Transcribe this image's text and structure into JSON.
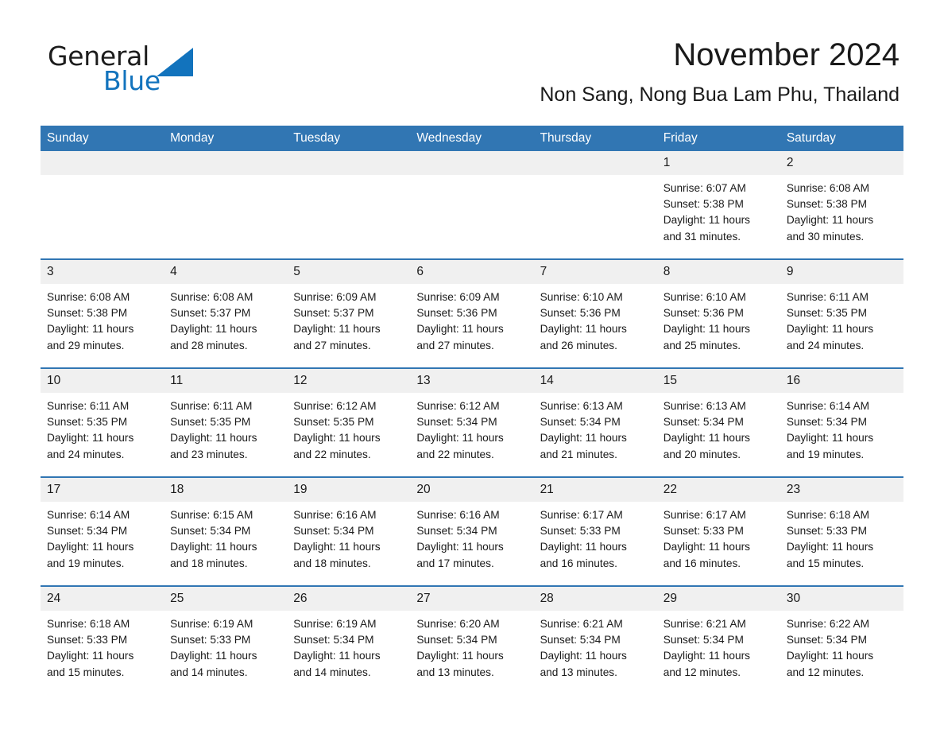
{
  "logo": {
    "word_one": "General",
    "word_two": "Blue",
    "triangle_icon": "triangle-icon",
    "brand_blue": "#1273bd"
  },
  "header": {
    "title": "November 2024",
    "subtitle": "Non Sang, Nong Bua Lam Phu, Thailand"
  },
  "theme": {
    "header_blue": "#3176b3",
    "daynum_gray": "#f0f0f0",
    "text": "#1a1a1a"
  },
  "calendar": {
    "weekday_headers": [
      "Sunday",
      "Monday",
      "Tuesday",
      "Wednesday",
      "Thursday",
      "Friday",
      "Saturday"
    ],
    "weeks": [
      {
        "days": [
          {
            "num": "",
            "sunrise": "",
            "sunset": "",
            "daylight1": "",
            "daylight2": ""
          },
          {
            "num": "",
            "sunrise": "",
            "sunset": "",
            "daylight1": "",
            "daylight2": ""
          },
          {
            "num": "",
            "sunrise": "",
            "sunset": "",
            "daylight1": "",
            "daylight2": ""
          },
          {
            "num": "",
            "sunrise": "",
            "sunset": "",
            "daylight1": "",
            "daylight2": ""
          },
          {
            "num": "",
            "sunrise": "",
            "sunset": "",
            "daylight1": "",
            "daylight2": ""
          },
          {
            "num": "1",
            "sunrise": "Sunrise: 6:07 AM",
            "sunset": "Sunset: 5:38 PM",
            "daylight1": "Daylight: 11 hours",
            "daylight2": "and 31 minutes."
          },
          {
            "num": "2",
            "sunrise": "Sunrise: 6:08 AM",
            "sunset": "Sunset: 5:38 PM",
            "daylight1": "Daylight: 11 hours",
            "daylight2": "and 30 minutes."
          }
        ]
      },
      {
        "days": [
          {
            "num": "3",
            "sunrise": "Sunrise: 6:08 AM",
            "sunset": "Sunset: 5:38 PM",
            "daylight1": "Daylight: 11 hours",
            "daylight2": "and 29 minutes."
          },
          {
            "num": "4",
            "sunrise": "Sunrise: 6:08 AM",
            "sunset": "Sunset: 5:37 PM",
            "daylight1": "Daylight: 11 hours",
            "daylight2": "and 28 minutes."
          },
          {
            "num": "5",
            "sunrise": "Sunrise: 6:09 AM",
            "sunset": "Sunset: 5:37 PM",
            "daylight1": "Daylight: 11 hours",
            "daylight2": "and 27 minutes."
          },
          {
            "num": "6",
            "sunrise": "Sunrise: 6:09 AM",
            "sunset": "Sunset: 5:36 PM",
            "daylight1": "Daylight: 11 hours",
            "daylight2": "and 27 minutes."
          },
          {
            "num": "7",
            "sunrise": "Sunrise: 6:10 AM",
            "sunset": "Sunset: 5:36 PM",
            "daylight1": "Daylight: 11 hours",
            "daylight2": "and 26 minutes."
          },
          {
            "num": "8",
            "sunrise": "Sunrise: 6:10 AM",
            "sunset": "Sunset: 5:36 PM",
            "daylight1": "Daylight: 11 hours",
            "daylight2": "and 25 minutes."
          },
          {
            "num": "9",
            "sunrise": "Sunrise: 6:11 AM",
            "sunset": "Sunset: 5:35 PM",
            "daylight1": "Daylight: 11 hours",
            "daylight2": "and 24 minutes."
          }
        ]
      },
      {
        "days": [
          {
            "num": "10",
            "sunrise": "Sunrise: 6:11 AM",
            "sunset": "Sunset: 5:35 PM",
            "daylight1": "Daylight: 11 hours",
            "daylight2": "and 24 minutes."
          },
          {
            "num": "11",
            "sunrise": "Sunrise: 6:11 AM",
            "sunset": "Sunset: 5:35 PM",
            "daylight1": "Daylight: 11 hours",
            "daylight2": "and 23 minutes."
          },
          {
            "num": "12",
            "sunrise": "Sunrise: 6:12 AM",
            "sunset": "Sunset: 5:35 PM",
            "daylight1": "Daylight: 11 hours",
            "daylight2": "and 22 minutes."
          },
          {
            "num": "13",
            "sunrise": "Sunrise: 6:12 AM",
            "sunset": "Sunset: 5:34 PM",
            "daylight1": "Daylight: 11 hours",
            "daylight2": "and 22 minutes."
          },
          {
            "num": "14",
            "sunrise": "Sunrise: 6:13 AM",
            "sunset": "Sunset: 5:34 PM",
            "daylight1": "Daylight: 11 hours",
            "daylight2": "and 21 minutes."
          },
          {
            "num": "15",
            "sunrise": "Sunrise: 6:13 AM",
            "sunset": "Sunset: 5:34 PM",
            "daylight1": "Daylight: 11 hours",
            "daylight2": "and 20 minutes."
          },
          {
            "num": "16",
            "sunrise": "Sunrise: 6:14 AM",
            "sunset": "Sunset: 5:34 PM",
            "daylight1": "Daylight: 11 hours",
            "daylight2": "and 19 minutes."
          }
        ]
      },
      {
        "days": [
          {
            "num": "17",
            "sunrise": "Sunrise: 6:14 AM",
            "sunset": "Sunset: 5:34 PM",
            "daylight1": "Daylight: 11 hours",
            "daylight2": "and 19 minutes."
          },
          {
            "num": "18",
            "sunrise": "Sunrise: 6:15 AM",
            "sunset": "Sunset: 5:34 PM",
            "daylight1": "Daylight: 11 hours",
            "daylight2": "and 18 minutes."
          },
          {
            "num": "19",
            "sunrise": "Sunrise: 6:16 AM",
            "sunset": "Sunset: 5:34 PM",
            "daylight1": "Daylight: 11 hours",
            "daylight2": "and 18 minutes."
          },
          {
            "num": "20",
            "sunrise": "Sunrise: 6:16 AM",
            "sunset": "Sunset: 5:34 PM",
            "daylight1": "Daylight: 11 hours",
            "daylight2": "and 17 minutes."
          },
          {
            "num": "21",
            "sunrise": "Sunrise: 6:17 AM",
            "sunset": "Sunset: 5:33 PM",
            "daylight1": "Daylight: 11 hours",
            "daylight2": "and 16 minutes."
          },
          {
            "num": "22",
            "sunrise": "Sunrise: 6:17 AM",
            "sunset": "Sunset: 5:33 PM",
            "daylight1": "Daylight: 11 hours",
            "daylight2": "and 16 minutes."
          },
          {
            "num": "23",
            "sunrise": "Sunrise: 6:18 AM",
            "sunset": "Sunset: 5:33 PM",
            "daylight1": "Daylight: 11 hours",
            "daylight2": "and 15 minutes."
          }
        ]
      },
      {
        "days": [
          {
            "num": "24",
            "sunrise": "Sunrise: 6:18 AM",
            "sunset": "Sunset: 5:33 PM",
            "daylight1": "Daylight: 11 hours",
            "daylight2": "and 15 minutes."
          },
          {
            "num": "25",
            "sunrise": "Sunrise: 6:19 AM",
            "sunset": "Sunset: 5:33 PM",
            "daylight1": "Daylight: 11 hours",
            "daylight2": "and 14 minutes."
          },
          {
            "num": "26",
            "sunrise": "Sunrise: 6:19 AM",
            "sunset": "Sunset: 5:34 PM",
            "daylight1": "Daylight: 11 hours",
            "daylight2": "and 14 minutes."
          },
          {
            "num": "27",
            "sunrise": "Sunrise: 6:20 AM",
            "sunset": "Sunset: 5:34 PM",
            "daylight1": "Daylight: 11 hours",
            "daylight2": "and 13 minutes."
          },
          {
            "num": "28",
            "sunrise": "Sunrise: 6:21 AM",
            "sunset": "Sunset: 5:34 PM",
            "daylight1": "Daylight: 11 hours",
            "daylight2": "and 13 minutes."
          },
          {
            "num": "29",
            "sunrise": "Sunrise: 6:21 AM",
            "sunset": "Sunset: 5:34 PM",
            "daylight1": "Daylight: 11 hours",
            "daylight2": "and 12 minutes."
          },
          {
            "num": "30",
            "sunrise": "Sunrise: 6:22 AM",
            "sunset": "Sunset: 5:34 PM",
            "daylight1": "Daylight: 11 hours",
            "daylight2": "and 12 minutes."
          }
        ]
      }
    ]
  }
}
